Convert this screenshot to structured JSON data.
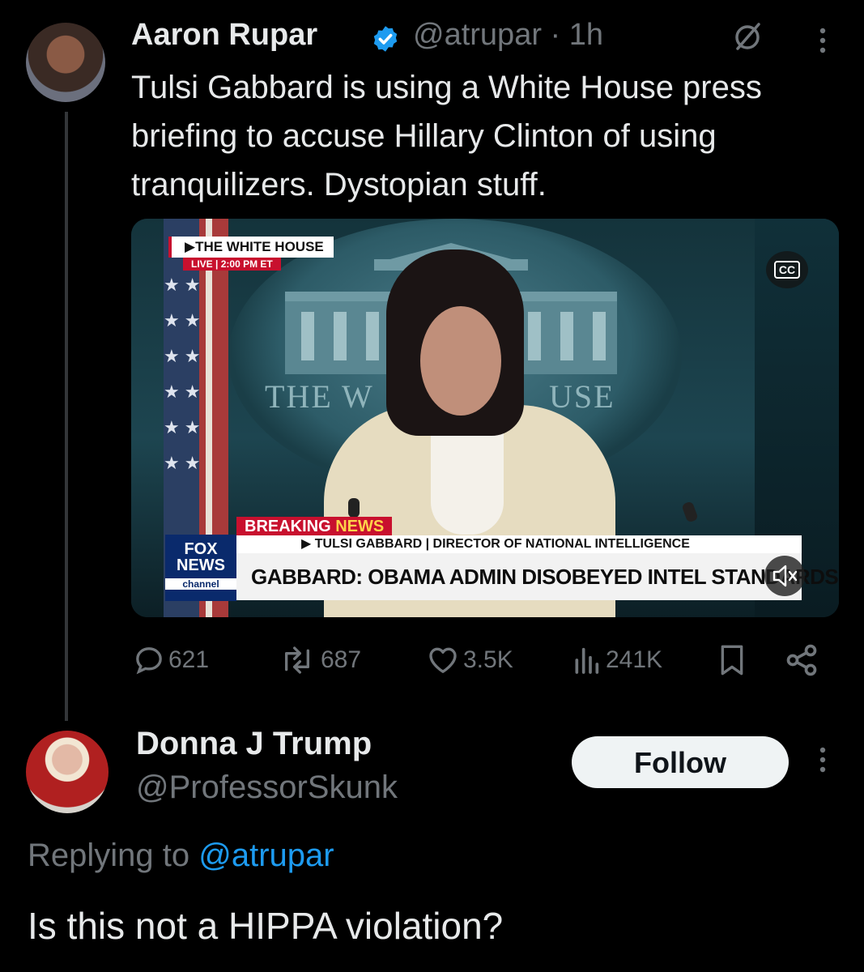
{
  "original_tweet": {
    "author_name": "Aaron Rupar",
    "handle": "@atrupar",
    "time_separator": "·",
    "time": "1h",
    "text": "Tulsi Gabbard is using a White House press briefing to accuse Hillary Clinton of using tranquilizers. Dystopian stuff.",
    "video": {
      "backdrop_left": "THE W",
      "backdrop_right": "USE",
      "source_label": "▶THE WHITE HOUSE",
      "live_label": "LIVE",
      "live_time": "2:00 PM ET",
      "breaking_word1": "BREAKING",
      "breaking_word2": "NEWS",
      "subtitle": "▶ TULSI GABBARD | DIRECTOR OF NATIONAL INTELLIGENCE",
      "headline": "GABBARD: OBAMA ADMIN DISOBEYED INTEL STANDARDS",
      "network_line1": "FOX",
      "network_line2": "NEWS",
      "network_line3": "channel",
      "cc_label": "CC"
    },
    "stats": {
      "replies": "621",
      "reposts": "687",
      "likes": "3.5K",
      "views": "241K"
    }
  },
  "reply": {
    "author_name": "Donna J Trump",
    "handle": "@ProfessorSkunk",
    "follow_label": "Follow",
    "replying_prefix": "Replying to",
    "replying_mention": "@atrupar",
    "text": "Is this not a HIPPA violation?"
  },
  "colors": {
    "background": "#000000",
    "primary_text": "#e7e9ea",
    "secondary_text": "#71767b",
    "link": "#1d9bf0",
    "verified_badge": "#1d9bf0",
    "fox_red": "#c8102e"
  }
}
